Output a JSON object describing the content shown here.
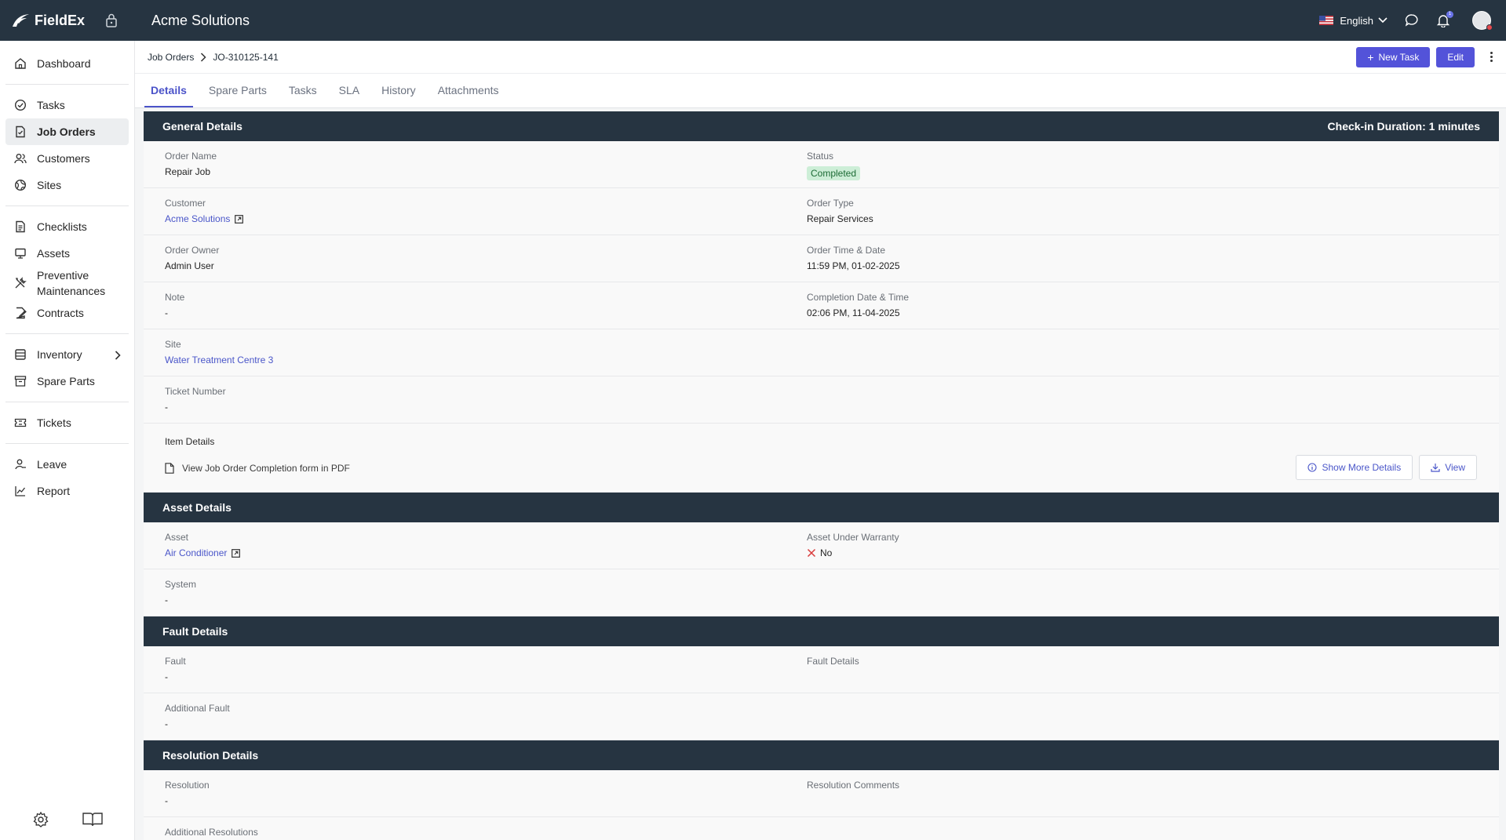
{
  "app": {
    "name": "FieldEx",
    "company": "Acme Solutions"
  },
  "topbar": {
    "language": "English",
    "notification_count": "1"
  },
  "sidebar": {
    "items": [
      {
        "label": "Dashboard"
      },
      {
        "label": "Tasks"
      },
      {
        "label": "Job Orders"
      },
      {
        "label": "Customers"
      },
      {
        "label": "Sites"
      },
      {
        "label": "Checklists"
      },
      {
        "label": "Assets"
      },
      {
        "label": "Preventive Maintenances",
        "line1": "Preventive",
        "line2": "Maintenances"
      },
      {
        "label": "Contracts"
      },
      {
        "label": "Inventory"
      },
      {
        "label": "Spare Parts"
      },
      {
        "label": "Tickets"
      },
      {
        "label": "Leave"
      },
      {
        "label": "Report"
      }
    ]
  },
  "breadcrumb": {
    "parent": "Job Orders",
    "current": "JO-310125-141"
  },
  "actions": {
    "new_task": "New Task",
    "edit": "Edit"
  },
  "tabs": [
    "Details",
    "Spare Parts",
    "Tasks",
    "SLA",
    "History",
    "Attachments"
  ],
  "general": {
    "title": "General Details",
    "checkin": "Check-in Duration: 1 minutes",
    "order_name": {
      "label": "Order Name",
      "value": "Repair Job"
    },
    "status": {
      "label": "Status",
      "value": "Completed"
    },
    "customer": {
      "label": "Customer",
      "value": "Acme Solutions"
    },
    "order_type": {
      "label": "Order Type",
      "value": "Repair Services"
    },
    "order_owner": {
      "label": "Order Owner",
      "value": "Admin User"
    },
    "order_time": {
      "label": "Order Time & Date",
      "value": "11:59 PM, 01-02-2025"
    },
    "note": {
      "label": "Note",
      "value": "-"
    },
    "completion": {
      "label": "Completion Date & Time",
      "value": "02:06 PM, 11-04-2025"
    },
    "site": {
      "label": "Site",
      "value": "Water Treatment Centre 3"
    },
    "ticket": {
      "label": "Ticket Number",
      "value": "-"
    },
    "item_details": "Item Details",
    "pdf_text": "View Job Order Completion form in PDF",
    "show_more": "Show More Details",
    "view": "View"
  },
  "asset": {
    "title": "Asset Details",
    "asset": {
      "label": "Asset",
      "value": "Air Conditioner"
    },
    "warranty": {
      "label": "Asset Under Warranty",
      "value": "No"
    },
    "system": {
      "label": "System",
      "value": "-"
    }
  },
  "fault": {
    "title": "Fault Details",
    "fault": {
      "label": "Fault",
      "value": "-"
    },
    "fault_details": {
      "label": "Fault Details",
      "value": ""
    },
    "additional": {
      "label": "Additional Fault",
      "value": "-"
    }
  },
  "resolution": {
    "title": "Resolution Details",
    "resolution": {
      "label": "Resolution",
      "value": "-"
    },
    "comments": {
      "label": "Resolution Comments",
      "value": ""
    },
    "additional": {
      "label": "Additional Resolutions"
    }
  },
  "colors": {
    "topbar": "#263441",
    "accent": "#5353d9",
    "link": "#4a56c9",
    "status_bg": "#cdeed7"
  }
}
